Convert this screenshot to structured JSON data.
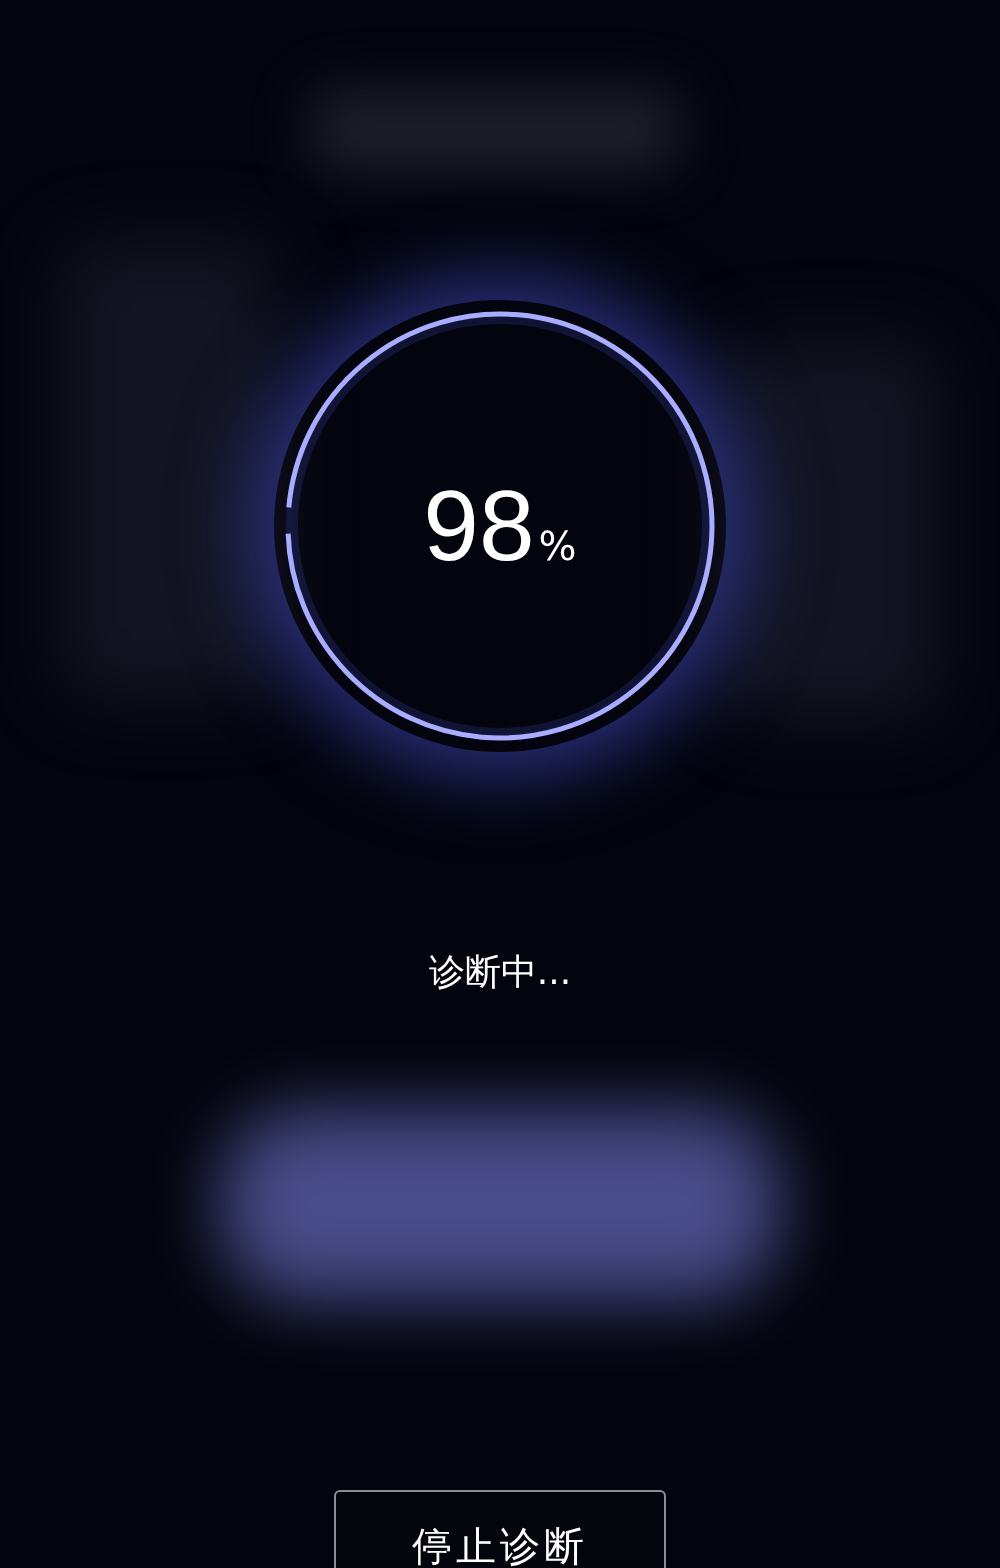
{
  "progress": {
    "value": "98",
    "unit": "%",
    "level": 0.98
  },
  "status": "诊断中...",
  "stop_button": {
    "label": "停止诊断"
  }
}
